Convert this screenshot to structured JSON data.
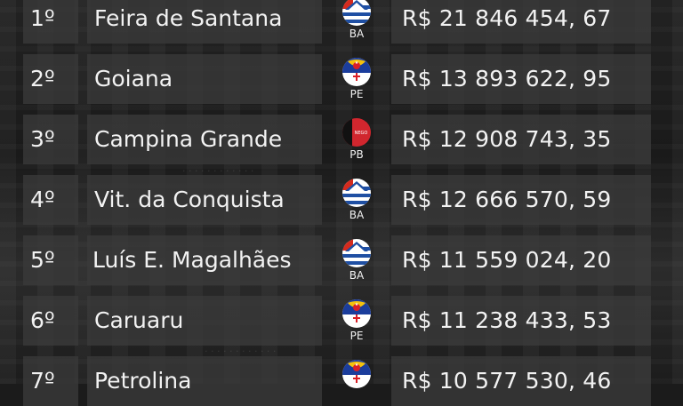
{
  "ranking": [
    {
      "rank": "1º",
      "city": "Feira de Santana",
      "state": "BA",
      "flag_icon": "bahia-flag-icon",
      "value": "R$ 21 846 454, 67"
    },
    {
      "rank": "2º",
      "city": "Goiana",
      "state": "PE",
      "flag_icon": "pernambuco-flag-icon",
      "value": "R$ 13 893 622, 95"
    },
    {
      "rank": "3º",
      "city": "Campina Grande",
      "state": "PB",
      "flag_icon": "paraiba-flag-icon",
      "value": "R$ 12 908 743, 35"
    },
    {
      "rank": "4º",
      "city": "Vit. da Conquista",
      "state": "BA",
      "flag_icon": "bahia-flag-icon",
      "value": "R$ 12 666 570, 59"
    },
    {
      "rank": "5º",
      "city": "Luís E. Magalhães",
      "state": "BA",
      "flag_icon": "bahia-flag-icon",
      "value": "R$ 11 559 024, 20"
    },
    {
      "rank": "6º",
      "city": "Caruaru",
      "state": "PE",
      "flag_icon": "pernambuco-flag-icon",
      "value": "R$ 11 238 433, 53"
    },
    {
      "rank": "7º",
      "city": "Petrolina",
      "state": "PE",
      "flag_icon": "pernambuco-flag-icon",
      "value": "R$ 10 577 530, 46"
    }
  ],
  "paraiba_flag_text": "NEGO",
  "colors": {
    "row_background": "#3a3a3a",
    "text": "#f2f2f2",
    "bahia_blue": "#1f4fa3",
    "bahia_red": "#d52b1e",
    "pernambuco_blue": "#1b3d9c",
    "paraiba_red": "#d1262e",
    "paraiba_black": "#111111"
  }
}
